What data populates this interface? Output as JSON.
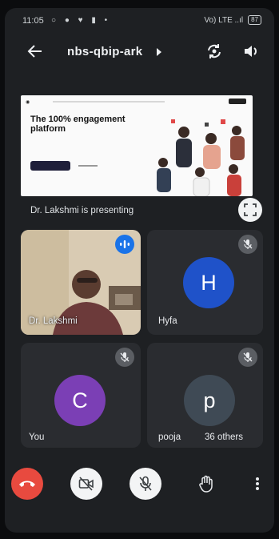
{
  "status_bar": {
    "time": "11:05",
    "icons_left": "○ ● ♥ ▮ •",
    "signal_text": "Vo) LTE  ..ıl",
    "battery": "87"
  },
  "header": {
    "meeting_code": "nbs-qbip-ark",
    "back_icon": "arrow-left-icon",
    "switch_camera_icon": "camera-switch-icon",
    "audio_icon": "speaker-icon"
  },
  "presentation": {
    "slide_headline": "The 100% engagement platform",
    "presenting_text": "Dr. Lakshmi is presenting",
    "fullscreen_icon": "fullscreen-icon"
  },
  "participants": [
    {
      "name": "Dr. Lakshmi",
      "state": "speaking",
      "video": true
    },
    {
      "name": "Hyfa",
      "initial": "H",
      "avatar_color": "#1f52c9",
      "state": "muted"
    },
    {
      "name": "You",
      "initial": "C",
      "avatar_color": "#7b3fb5",
      "state": "muted"
    },
    {
      "name": "pooja",
      "initial": "p",
      "avatar_color": "#3f4a55",
      "state": "muted",
      "others": "36 others"
    }
  ],
  "controls": {
    "end_call_icon": "phone-hangup-icon",
    "camera_icon": "camera-off-icon",
    "mic_icon": "mic-off-icon",
    "hand_icon": "raise-hand-icon",
    "more_icon": "more-vert-icon"
  },
  "colors": {
    "end_call": "#e84a3f",
    "speaking_badge": "#1a73e8",
    "background": "#1e2023"
  }
}
